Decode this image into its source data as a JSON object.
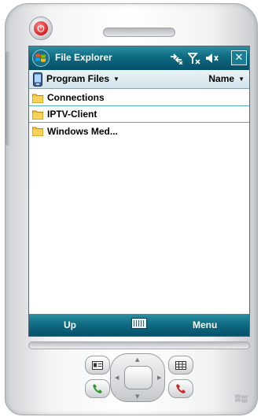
{
  "title_bar": {
    "app_title": "File Explorer",
    "close_label": "✕",
    "status_icons": [
      "connectivity-icon",
      "signal-off-icon",
      "volume-off-icon"
    ]
  },
  "folder_bar": {
    "current_folder": "Program Files",
    "sort_by": "Name"
  },
  "files": [
    {
      "name": "Connections",
      "icon": "folder-icon"
    },
    {
      "name": "IPTV-Client",
      "icon": "folder-icon"
    },
    {
      "name": "Windows Med...",
      "icon": "folder-icon"
    }
  ],
  "menu_bar": {
    "left_softkey": "Up",
    "right_softkey": "Menu",
    "keyboard_icon": "keyboard-icon"
  },
  "colors": {
    "titlebar": "#0e6a80",
    "row_divider": "#4fb0c6",
    "power_red": "#d51f1f"
  }
}
